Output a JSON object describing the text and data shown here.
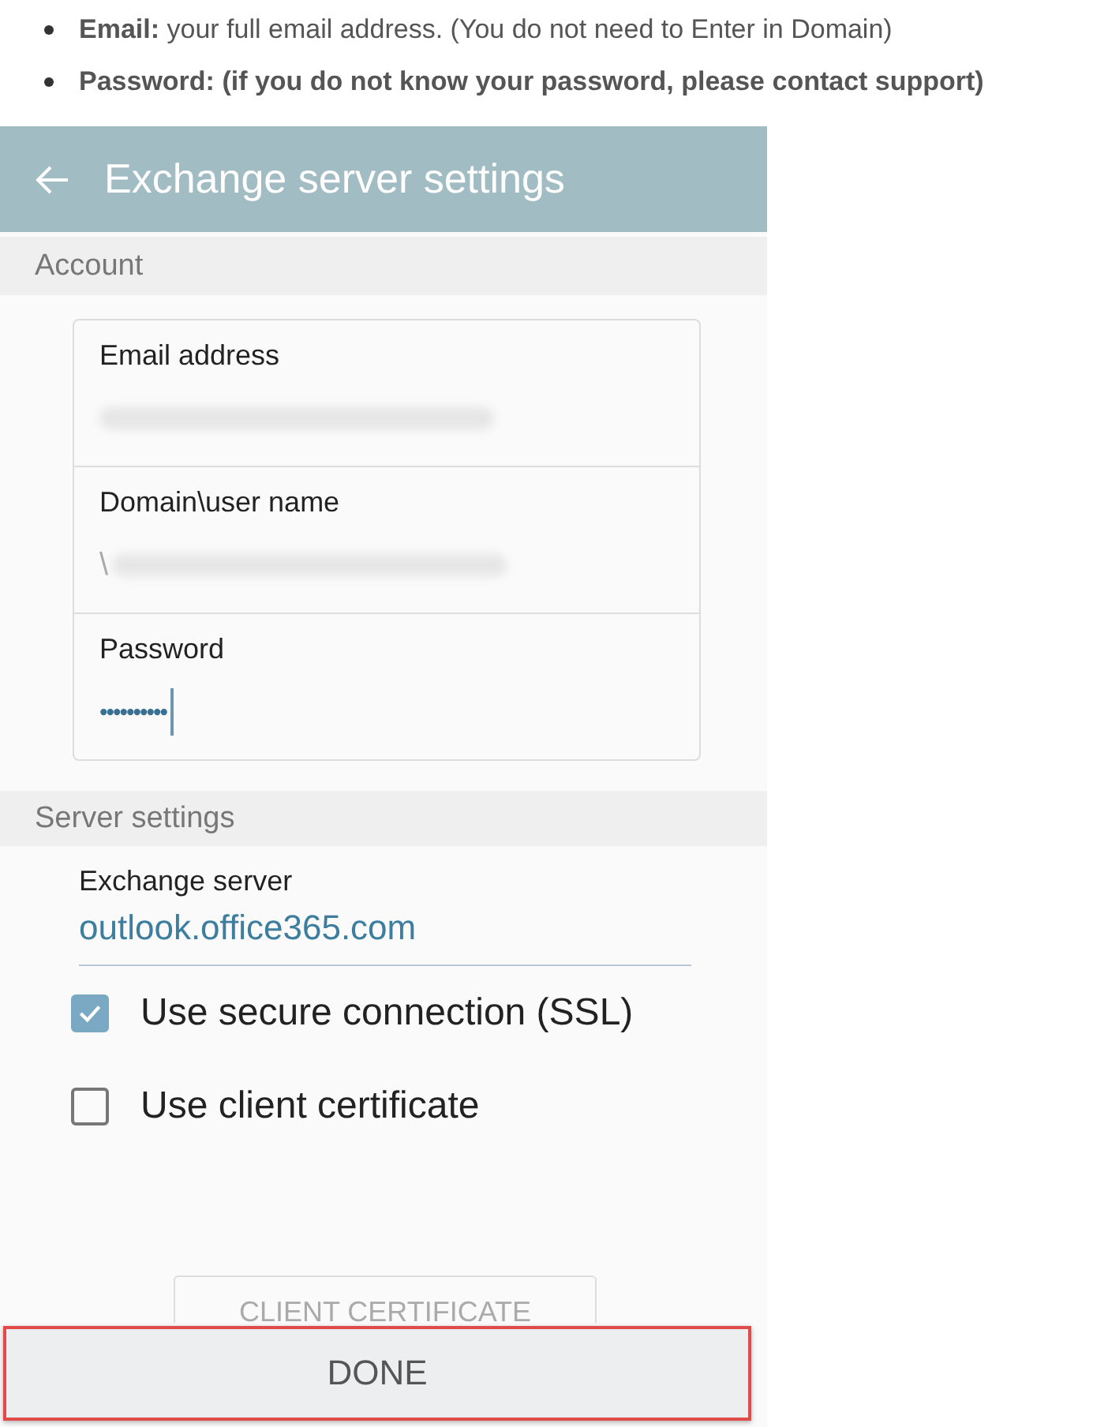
{
  "instructions": [
    {
      "text": "**Email:** your full email address. (You do not need to Enter in Domain)"
    },
    {
      "text": "**Password: (if you do not know your password, please contact support)**"
    }
  ],
  "app_bar": {
    "title": "Exchange server settings"
  },
  "account": {
    "heading": "Account",
    "fields": [
      {
        "label": "Email address",
        "kind": "blurred"
      },
      {
        "label": "Domain\\user name",
        "value": "\\",
        "kind": "blurred"
      },
      {
        "label": "Password",
        "value": "••••••••••",
        "kind": "password"
      }
    ]
  },
  "server": {
    "heading": "Server settings",
    "label": "Exchange server",
    "value": "outlook.office365.com",
    "options": [
      {
        "label": "Use secure connection (SSL)",
        "checked": true
      },
      {
        "label": "Use client certificate",
        "checked": false
      }
    ],
    "certificate_button": "CLIENT CERTIFICATE"
  },
  "done_button": {
    "label": "DONE"
  }
}
